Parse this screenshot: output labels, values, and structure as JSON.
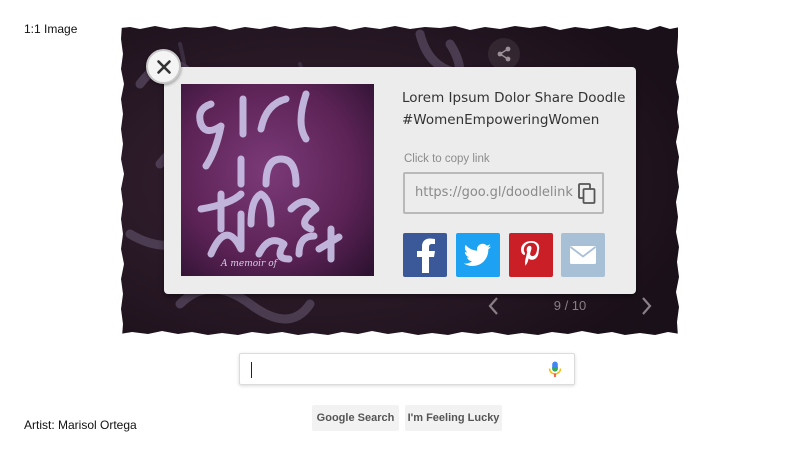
{
  "page": {
    "corner_label": "1:1 Image",
    "artist": "Artist: Marisol Ortega"
  },
  "doodle": {
    "counter": "9 / 10",
    "background_color": "#1f1420"
  },
  "dialog": {
    "title_line1": "Lorem Ipsum Dolor Share Doodle",
    "title_line2": "#WomenEmpoweringWomen",
    "copy_label": "Click to copy link",
    "link": "https://goo.gl/doodlelink",
    "thumbnail_caption": "A memoir of",
    "social": [
      {
        "name": "facebook",
        "color": "#3b5998"
      },
      {
        "name": "twitter",
        "color": "#1da1f2"
      },
      {
        "name": "pinterest",
        "color": "#cb1f27"
      },
      {
        "name": "email",
        "color": "#a8c0d6"
      }
    ]
  },
  "search": {
    "value": "",
    "google_search_label": "Google Search",
    "lucky_label": "I'm Feeling Lucky"
  },
  "icons": [
    "close-icon",
    "share-icon",
    "copy-icon",
    "facebook-icon",
    "twitter-icon",
    "pinterest-icon",
    "email-icon",
    "chevron-left-icon",
    "chevron-right-icon",
    "microphone-icon"
  ]
}
